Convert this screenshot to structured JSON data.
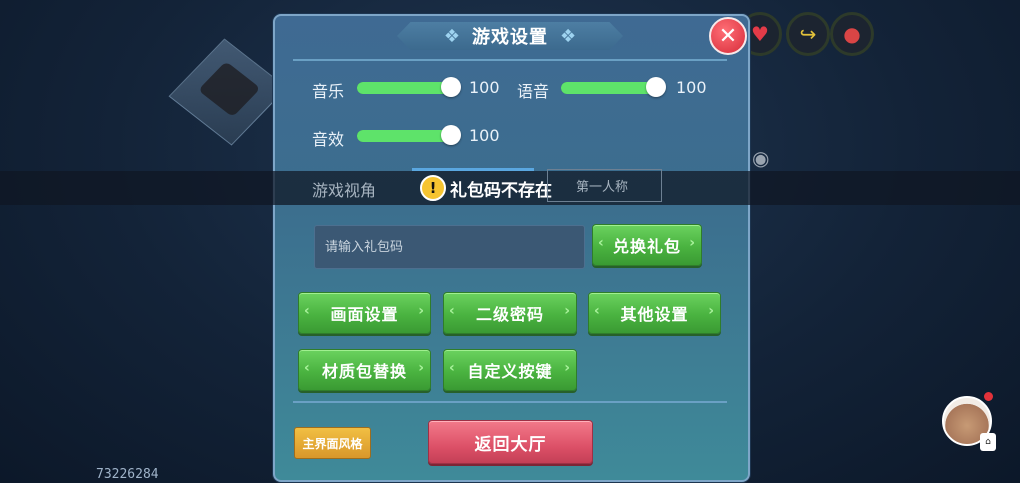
{
  "background": {
    "seed_number": "73226284"
  },
  "hud": {
    "icons": [
      "heart-icon",
      "share-icon",
      "drop-icon"
    ]
  },
  "panel": {
    "title": "游戏设置",
    "close_symbol": "✕",
    "sliders": [
      {
        "label": "音乐",
        "value": "100",
        "level": 1.0
      },
      {
        "label": "语音",
        "value": "100",
        "level": 1.0
      },
      {
        "label": "音效",
        "value": "100",
        "level": 1.0
      }
    ],
    "view": {
      "label": "游戏视角",
      "option_first_person": "第一人称"
    },
    "toast": {
      "text": "礼包码不存在"
    },
    "gift": {
      "placeholder": "请输入礼包码",
      "redeem_label": "兑换礼包"
    },
    "buttons": {
      "graphics": "画面设置",
      "secondary_password": "二级密码",
      "other": "其他设置",
      "texture_pack": "材质包替换",
      "custom_keys": "自定义按键"
    },
    "main_style_label": "主界面风格",
    "return_lobby_label": "返回大厅"
  },
  "colors": {
    "green_button": "#4ab340",
    "red_button": "#dd5168",
    "gold_button": "#e0a430",
    "slider_fill": "#5ee36a"
  }
}
